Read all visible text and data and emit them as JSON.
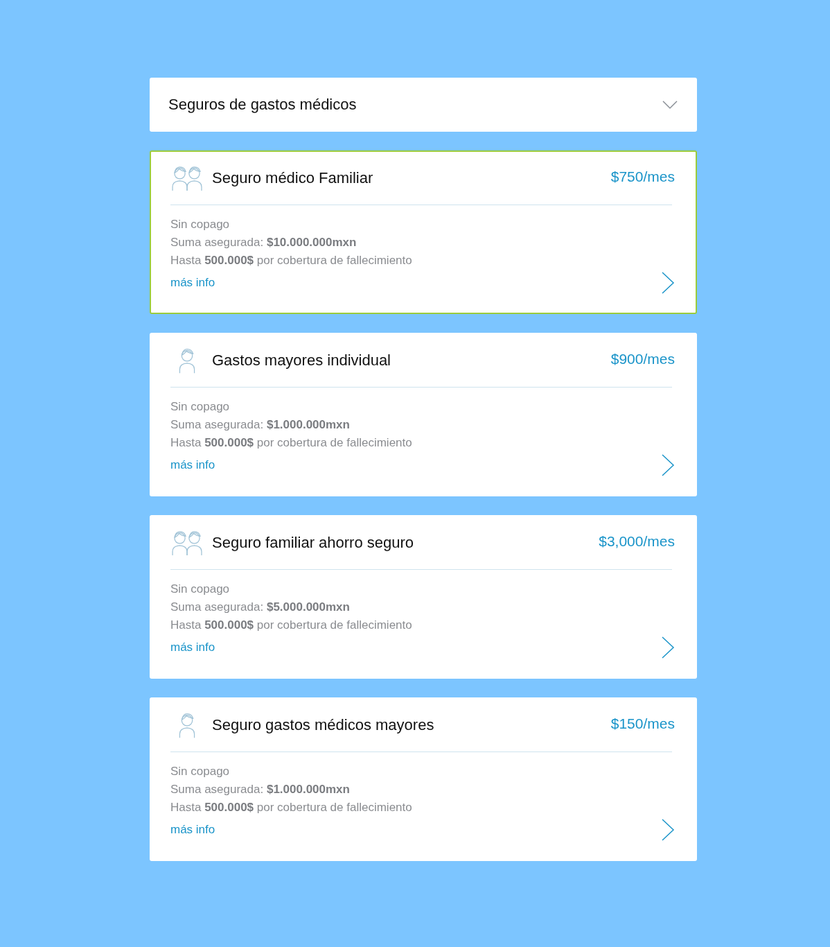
{
  "dropdown": {
    "label": "Seguros de gastos médicos",
    "expanded": false
  },
  "plans": [
    {
      "kind": "family",
      "title": "Seguro médico Familiar",
      "price": "$750/mes",
      "selected": true,
      "lines": [
        "Sin copago",
        "Suma asegurada: **$10.000.000mxn**",
        "Hasta **500.000$** por cobertura de fallecimiento"
      ],
      "link": "más info"
    },
    {
      "kind": "individual",
      "title": "Gastos mayores individual",
      "price": "$900/mes",
      "selected": false,
      "lines": [
        "Sin copago",
        "Suma asegurada: **$1.000.000mxn**",
        "Hasta **500.000$** por cobertura de fallecimiento"
      ],
      "link": "más info"
    },
    {
      "kind": "family",
      "title": "Seguro familiar ahorro seguro",
      "price": "$3,000/mes",
      "selected": false,
      "lines": [
        "Sin copago",
        "Suma asegurada: **$5.000.000mxn**",
        "Hasta **500.000$** por cobertura de fallecimiento"
      ],
      "link": "más info"
    },
    {
      "kind": "individual",
      "title": "Seguro gastos médicos mayores",
      "price": "$150/mes",
      "selected": false,
      "lines": [
        "Sin copago",
        "Suma asegurada: **$1.000.000mxn**",
        "Hasta **500.000$** por cobertura de fallecimiento"
      ],
      "link": "más info"
    }
  ]
}
